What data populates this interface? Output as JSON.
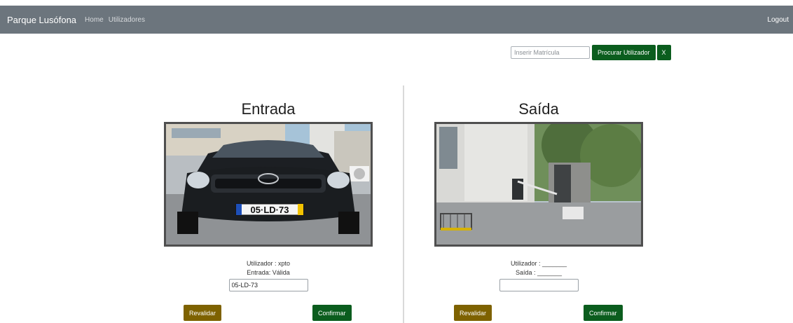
{
  "navbar": {
    "brand": "Parque Lusófona",
    "links": [
      "Home",
      "Utilizadores"
    ],
    "logout": "Logout"
  },
  "search": {
    "placeholder": "Inserir Matrícula",
    "button": "Procurar Utilizador",
    "clear": "X"
  },
  "entrada": {
    "title": "Entrada",
    "plate_text": "05·LD·73",
    "user_line": "Utilizador : xpto",
    "status_line": "Entrada: Válida",
    "plate_value": "05-LD-73",
    "revalidate": "Revalidar",
    "confirm": "Confirmar"
  },
  "saida": {
    "title": "Saída",
    "user_line": "Utilizador : _______",
    "status_line": "Saída : _______",
    "plate_value": "",
    "revalidate": "Revalidar",
    "confirm": "Confirmar"
  },
  "colors": {
    "navbar": "#6c757d",
    "confirm": "#0b5d1e",
    "revalidate": "#7e6200"
  }
}
